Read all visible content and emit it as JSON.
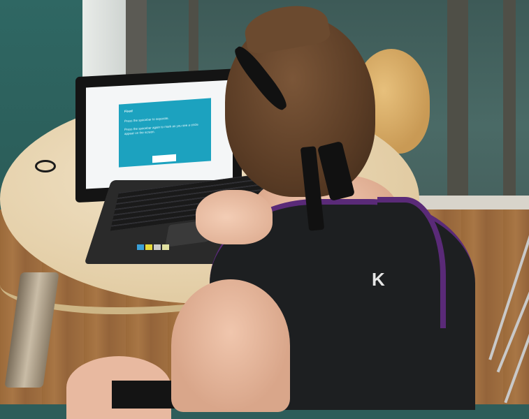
{
  "photo": {
    "subject": "person using laptop at round table",
    "colors": {
      "wall": "#2f6763",
      "table": "#e4cfa8",
      "floor": "#a87645",
      "dialog": "#1ca2bf",
      "tank_top": "#1d1f21",
      "tank_trim": "#5a2a78"
    }
  },
  "laptop_screen": {
    "dialog_title": "Fixed",
    "dialog_line1": "Press the spacebar to separate.",
    "dialog_line2": "Press the spacebar again to mark as you see a circle",
    "dialog_line3": "appear on the screen."
  },
  "shirt": {
    "logo": "K"
  }
}
